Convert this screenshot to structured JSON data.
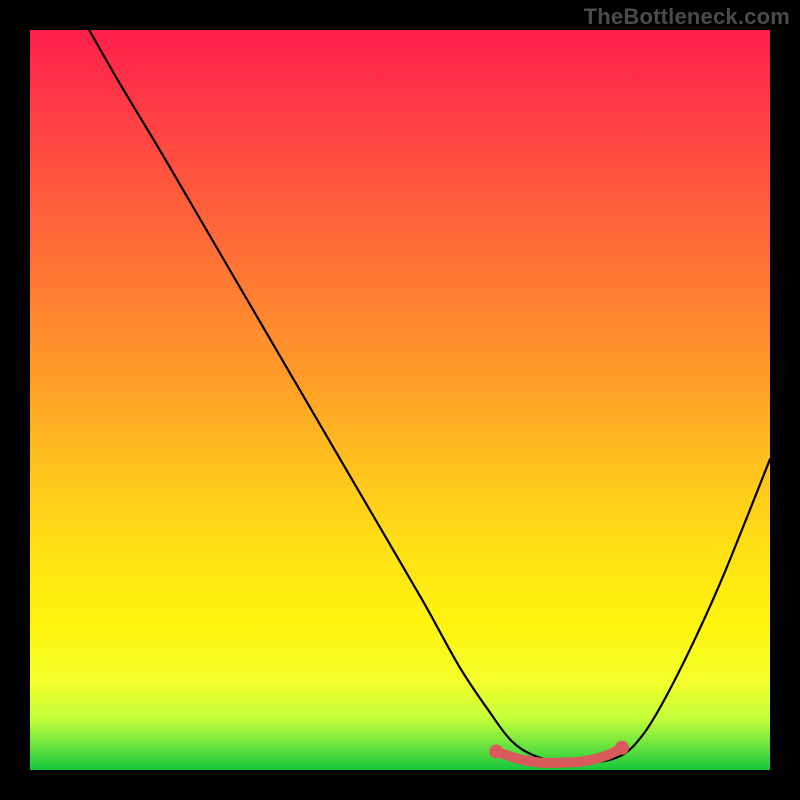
{
  "watermark": "TheBottleneck.com",
  "chart_data": {
    "type": "line",
    "title": "",
    "xlabel": "",
    "ylabel": "",
    "xlim": [
      0,
      100
    ],
    "ylim": [
      0,
      100
    ],
    "series": [
      {
        "name": "curve",
        "x": [
          8,
          12,
          18,
          25,
          32,
          39,
          46,
          53,
          58,
          62,
          65,
          68,
          72,
          76,
          80,
          83,
          86,
          90,
          94,
          100
        ],
        "y": [
          100,
          93,
          83,
          71,
          59,
          47,
          35,
          23,
          14,
          8,
          4,
          2,
          1,
          1,
          2,
          5,
          10,
          18,
          27,
          42
        ]
      },
      {
        "name": "highlight-segment",
        "x": [
          63,
          66,
          69,
          72,
          75,
          78,
          80
        ],
        "y": [
          2.5,
          1.5,
          1,
          1,
          1.2,
          2,
          3
        ]
      }
    ],
    "highlight_color": "#d85a5a",
    "curve_color": "#000000"
  }
}
